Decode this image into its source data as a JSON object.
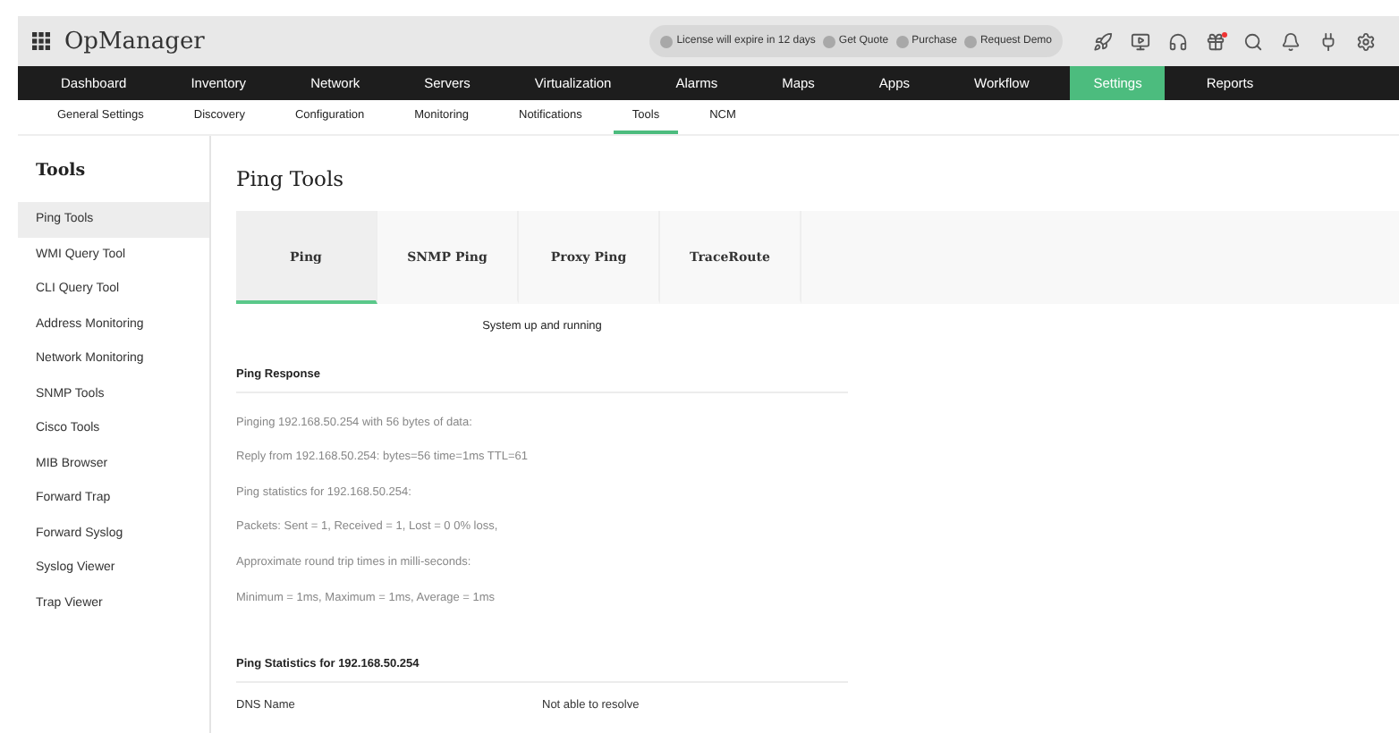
{
  "app": {
    "title": "OpManager"
  },
  "header_links": [
    {
      "label": "License will expire in 12 days"
    },
    {
      "label": "Get Quote"
    },
    {
      "label": "Purchase"
    },
    {
      "label": "Request Demo"
    }
  ],
  "gift_notification": true,
  "nav": [
    {
      "label": "Dashboard",
      "selected": false
    },
    {
      "label": "Inventory",
      "selected": false
    },
    {
      "label": "Network",
      "selected": false
    },
    {
      "label": "Servers",
      "selected": false
    },
    {
      "label": "Virtualization",
      "selected": false
    },
    {
      "label": "Alarms",
      "selected": false
    },
    {
      "label": "Maps",
      "selected": false
    },
    {
      "label": "Apps",
      "selected": false
    },
    {
      "label": "Workflow",
      "selected": false
    },
    {
      "label": "Settings",
      "selected": true
    },
    {
      "label": "Reports",
      "selected": false
    }
  ],
  "subnav": [
    {
      "label": "General Settings",
      "selected": false
    },
    {
      "label": "Discovery",
      "selected": false
    },
    {
      "label": "Configuration",
      "selected": false
    },
    {
      "label": "Monitoring",
      "selected": false
    },
    {
      "label": "Notifications",
      "selected": false
    },
    {
      "label": "Tools",
      "selected": true
    },
    {
      "label": "NCM",
      "selected": false
    }
  ],
  "sidebar": {
    "title": "Tools",
    "items": [
      {
        "label": "Ping Tools",
        "selected": true
      },
      {
        "label": "WMI Query Tool",
        "selected": false
      },
      {
        "label": "CLI Query Tool",
        "selected": false
      },
      {
        "label": "Address Monitoring",
        "selected": false
      },
      {
        "label": "Network Monitoring",
        "selected": false
      },
      {
        "label": "SNMP Tools",
        "selected": false
      },
      {
        "label": "Cisco Tools",
        "selected": false
      },
      {
        "label": "MIB Browser",
        "selected": false
      },
      {
        "label": "Forward Trap",
        "selected": false
      },
      {
        "label": "Forward Syslog",
        "selected": false
      },
      {
        "label": "Syslog Viewer",
        "selected": false
      },
      {
        "label": "Trap Viewer",
        "selected": false
      }
    ]
  },
  "page": {
    "title": "Ping Tools",
    "tabs": [
      {
        "label": "Ping",
        "selected": true
      },
      {
        "label": "SNMP Ping",
        "selected": false
      },
      {
        "label": "Proxy Ping",
        "selected": false
      },
      {
        "label": "TraceRoute",
        "selected": false
      }
    ],
    "status": "System up and running",
    "response": {
      "title": "Ping Response",
      "lines": [
        "Pinging 192.168.50.254 with 56 bytes of data:",
        "Reply from 192.168.50.254: bytes=56 time=1ms TTL=61",
        "Ping statistics for 192.168.50.254:",
        "Packets: Sent = 1, Received = 1, Lost = 0 0% loss,",
        "Approximate round trip times in milli-seconds:",
        "Minimum = 1ms, Maximum = 1ms, Average = 1ms"
      ]
    },
    "statistics": {
      "title": "Ping Statistics for 192.168.50.254",
      "rows": [
        {
          "label": "DNS Name",
          "value": "Not able to resolve"
        }
      ]
    }
  }
}
